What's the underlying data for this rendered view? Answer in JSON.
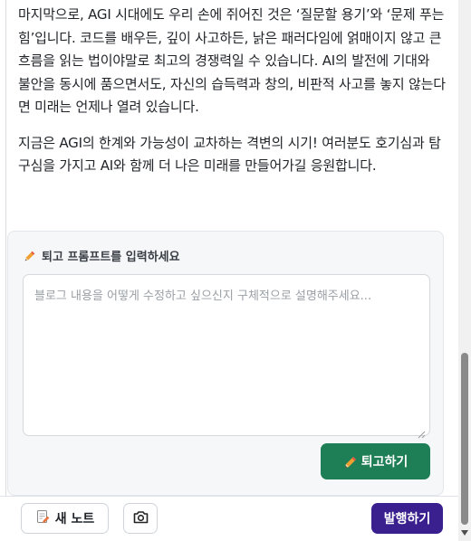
{
  "article": {
    "paragraph1": "마지막으로, AGI 시대에도 우리 손에 쥐어진 것은 ‘질문할 용기’와 ‘문제 푸는 힘’입니다. 코드를 배우든, 깊이 사고하든, 낡은 패러다임에 얽매이지 않고 큰 흐름을 읽는 법이야말로 최고의 경쟁력일 수 있습니다. AI의 발전에 기대와 불안을 동시에 품으면서도, 자신의 습득력과 창의, 비판적 사고를 놓지 않는다면 미래는 언제나 열려 있습니다.",
    "paragraph2": "지금은 AGI의 한계와 가능성이 교차하는 격변의 시기! 여러분도 호기심과 탐구심을 가지고 AI와 함께 더 나은 미래를 만들어가길 응원합니다."
  },
  "edit_panel": {
    "label": "퇴고 프롬프트를 입력하세요",
    "placeholder": "블로그 내용을 어떻게 수정하고 싶으신지 구체적으로 설명해주세요...",
    "input_value": "",
    "submit_label": "퇴고하기"
  },
  "footer": {
    "new_note_label": "새 노트",
    "publish_label": "발행하기"
  },
  "icons": {
    "pencil": "pencil-icon",
    "note": "note-icon",
    "camera": "camera-icon"
  },
  "colors": {
    "submit": "#1e7e55",
    "publish": "#3a1f8f"
  }
}
